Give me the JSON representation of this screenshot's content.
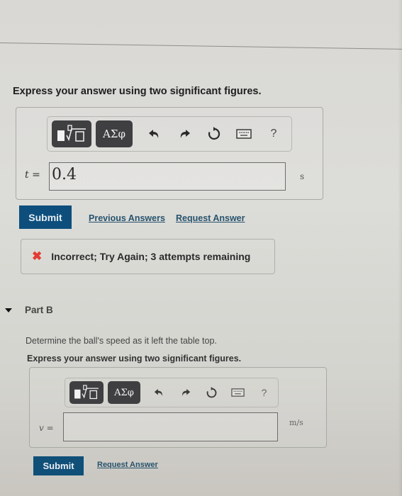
{
  "partA": {
    "instruction": "Express your answer using two significant figures.",
    "toolbar": {
      "templates_label": "■√□",
      "greek_label": "ΑΣφ",
      "undo_icon": "↶",
      "redo_icon": "↷",
      "reset_icon": "↻",
      "keyboard_icon": "⌨",
      "help_label": "?"
    },
    "variable_label": "t =",
    "answer_value": "0.4",
    "unit": "s",
    "submit_label": "Submit",
    "previous_answers_label": "Previous Answers",
    "request_answer_label": "Request Answer",
    "feedback": {
      "icon": "✖",
      "text": "Incorrect; Try Again; 3 attempts remaining",
      "icon_color": "#e33b33"
    }
  },
  "partB": {
    "title": "Part B",
    "question": "Determine the ball's speed as it left the table top.",
    "instruction": "Express your answer using two significant figures.",
    "toolbar": {
      "templates_label": "■√□",
      "greek_label": "ΑΣφ",
      "undo_icon": "↶",
      "redo_icon": "↷",
      "reset_icon": "↻",
      "keyboard_icon": "⌨",
      "help_label": "?"
    },
    "variable_label": "v =",
    "answer_value": "",
    "unit": "m/s",
    "submit_label": "Submit",
    "request_answer_label": "Request Answer"
  },
  "colors": {
    "submit_bg": "#0d4e7c",
    "link": "#27536d",
    "toolbar_button_bg": "#3f3f42"
  }
}
